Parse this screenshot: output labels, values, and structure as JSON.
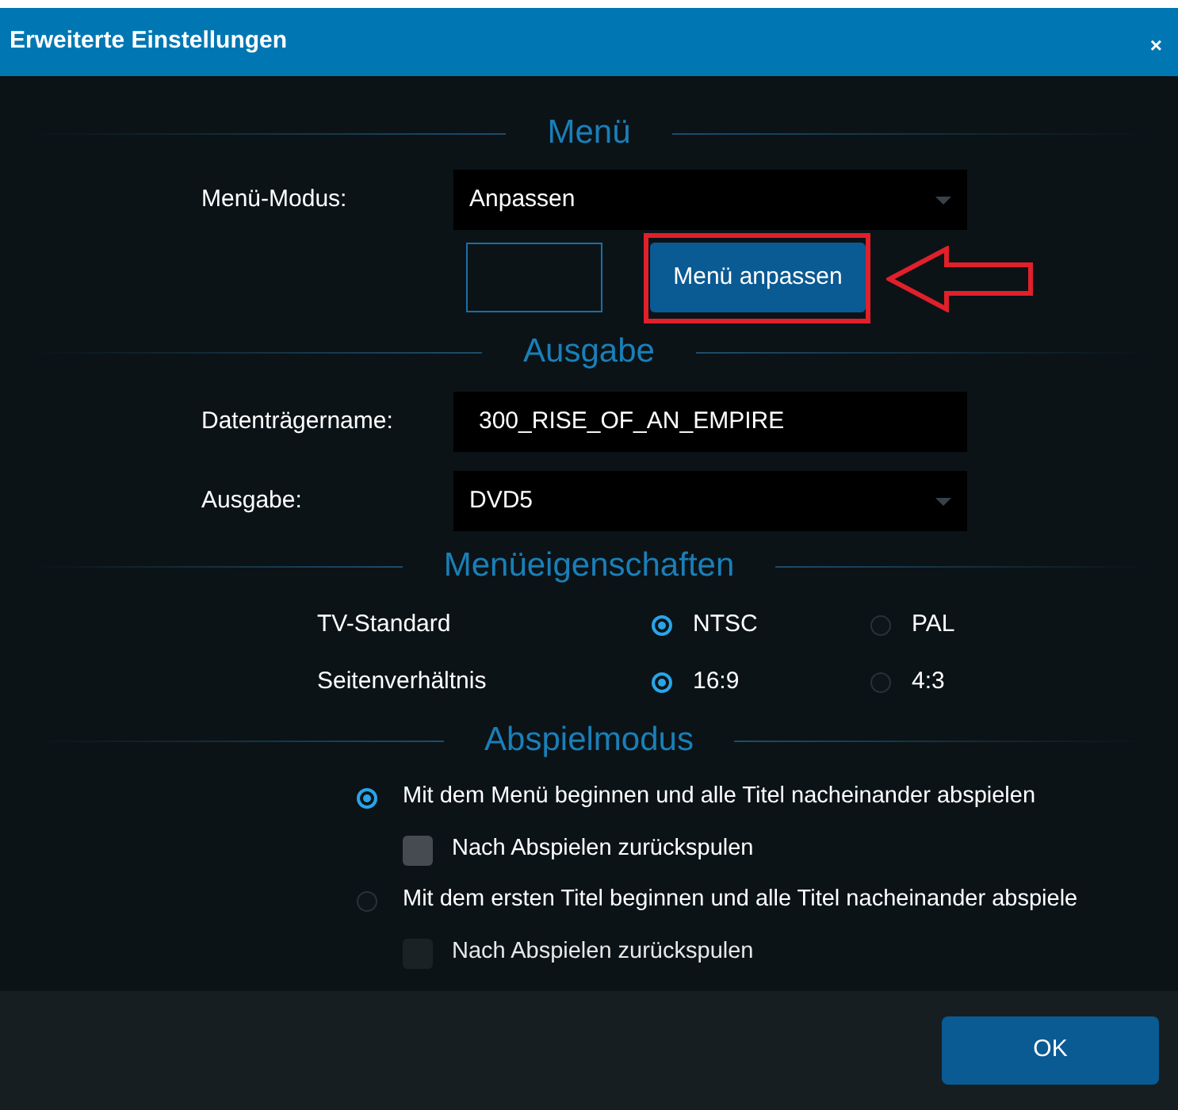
{
  "window": {
    "title": "Erweiterte Einstellungen",
    "close": "×"
  },
  "sections": [
    {
      "title": "Menü",
      "items": [
        {
          "kind": "select",
          "label": "Menü-Modus:",
          "value": "Anpassen"
        },
        {
          "kind": "button",
          "label": "Menü anpassen",
          "highlighted": true
        }
      ]
    },
    {
      "title": "Ausgabe",
      "items": [
        {
          "kind": "text",
          "label": "Datenträgername:",
          "value": "300_RISE_OF_AN_EMPIRE"
        },
        {
          "kind": "select",
          "label": "Ausgabe:",
          "value": "DVD5"
        }
      ]
    },
    {
      "title": "Menüeigenschaften",
      "items": [
        {
          "kind": "choice",
          "label": "TV-Standard",
          "options": [
            {
              "label": "NTSC",
              "selected": true
            },
            {
              "label": "PAL",
              "selected": false
            }
          ]
        },
        {
          "kind": "choice",
          "label": "Seitenverhältnis",
          "options": [
            {
              "label": "16:9",
              "selected": true
            },
            {
              "label": "4:3",
              "selected": false
            }
          ]
        }
      ]
    },
    {
      "title": "Abspielmodus",
      "items": [
        {
          "kind": "mode",
          "label": "Mit dem Menü beginnen und alle Titel nacheinander abspielen",
          "selected": true,
          "rewind": {
            "label": "Nach Abspielen zurückspulen",
            "checked": false,
            "disabled": false
          }
        },
        {
          "kind": "mode",
          "label": "Mit dem ersten Titel beginnen und alle Titel nacheinander abspiele",
          "selected": false,
          "rewind": {
            "label": "Nach Abspielen zurückspulen",
            "checked": false,
            "disabled": true
          }
        }
      ]
    }
  ],
  "buttons": [
    {
      "label": "OK"
    }
  ]
}
